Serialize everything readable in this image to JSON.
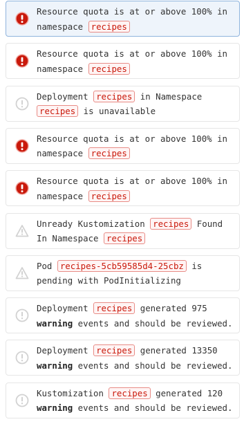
{
  "alerts": [
    {
      "severity": "critical",
      "selected": true,
      "icon": "exclamation-circle-icon",
      "segments": [
        {
          "text": "Resource quota is at or above 100% in namespace "
        },
        {
          "text": "recipes",
          "tag": true
        }
      ]
    },
    {
      "severity": "critical",
      "selected": false,
      "icon": "exclamation-circle-icon",
      "segments": [
        {
          "text": "Resource quota is at or above 100% in namespace "
        },
        {
          "text": "recipes",
          "tag": true
        }
      ]
    },
    {
      "severity": "info",
      "selected": false,
      "icon": "exclamation-circle-outline-icon",
      "segments": [
        {
          "text": "Deployment "
        },
        {
          "text": "recipes",
          "tag": true
        },
        {
          "text": " in Namespace "
        },
        {
          "text": "recipes",
          "tag": true
        },
        {
          "text": " is unavailable"
        }
      ]
    },
    {
      "severity": "critical",
      "selected": false,
      "icon": "exclamation-circle-icon",
      "segments": [
        {
          "text": "Resource quota is at or above 100% in namespace "
        },
        {
          "text": "recipes",
          "tag": true
        }
      ]
    },
    {
      "severity": "critical",
      "selected": false,
      "icon": "exclamation-circle-icon",
      "segments": [
        {
          "text": "Resource quota is at or above 100% in namespace "
        },
        {
          "text": "recipes",
          "tag": true
        }
      ]
    },
    {
      "severity": "warning",
      "selected": false,
      "icon": "warning-triangle-icon",
      "segments": [
        {
          "text": "Unready Kustomization "
        },
        {
          "text": "recipes",
          "tag": true
        },
        {
          "text": " Found In Namespace "
        },
        {
          "text": "recipes",
          "tag": true
        }
      ]
    },
    {
      "severity": "warning",
      "selected": false,
      "icon": "warning-triangle-icon",
      "segments": [
        {
          "text": "Pod "
        },
        {
          "text": "recipes-5cb59585d4-25cbz",
          "tag": true
        },
        {
          "text": " is pending with PodInitializing"
        }
      ]
    },
    {
      "severity": "info",
      "selected": false,
      "icon": "exclamation-circle-outline-icon",
      "segments": [
        {
          "text": "Deployment "
        },
        {
          "text": "recipes",
          "tag": true
        },
        {
          "text": " generated 975 "
        },
        {
          "text": "warning",
          "bold": true
        },
        {
          "text": " events and should be reviewed."
        }
      ]
    },
    {
      "severity": "info",
      "selected": false,
      "icon": "exclamation-circle-outline-icon",
      "segments": [
        {
          "text": "Deployment "
        },
        {
          "text": "recipes",
          "tag": true
        },
        {
          "text": " generated 13350 "
        },
        {
          "text": "warning",
          "bold": true
        },
        {
          "text": " events and should be reviewed."
        }
      ]
    },
    {
      "severity": "info",
      "selected": false,
      "icon": "exclamation-circle-outline-icon",
      "segments": [
        {
          "text": "Kustomization "
        },
        {
          "text": "recipes",
          "tag": true
        },
        {
          "text": " generated 120 "
        },
        {
          "text": "warning",
          "bold": true
        },
        {
          "text": " events and should be reviewed."
        }
      ]
    }
  ],
  "colors": {
    "critical": "#c9190b",
    "faded_icon": "#d2d2d2",
    "tag_text": "#c9190b",
    "tag_border": "#e88b85",
    "selected_bg": "#eef4fb",
    "selected_border": "#8fb4dd"
  }
}
